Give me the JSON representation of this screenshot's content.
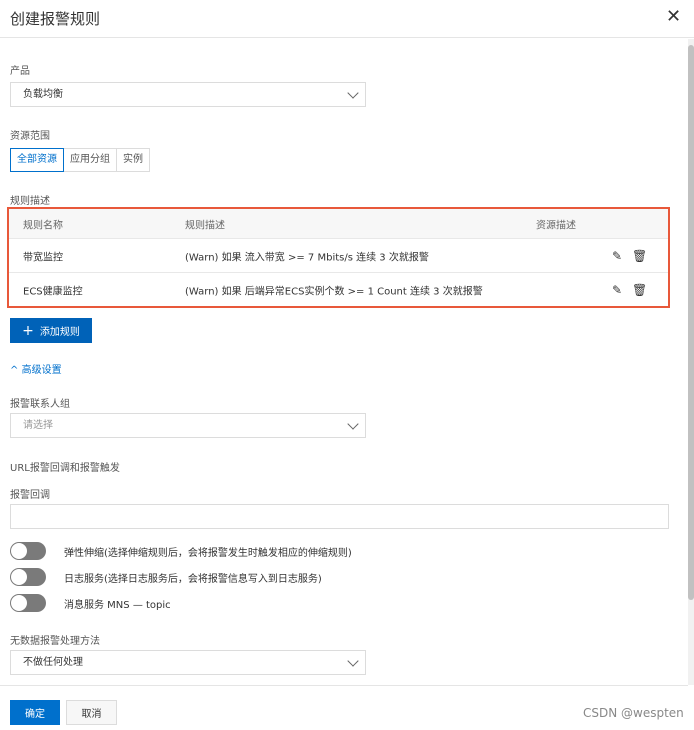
{
  "dialog": {
    "title": "创建报警规则",
    "close_icon": "close-icon"
  },
  "product": {
    "label": "产品",
    "value": "负载均衡"
  },
  "scope": {
    "label": "资源范围",
    "tabs": [
      "全部资源",
      "应用分组",
      "实例"
    ],
    "active": 0
  },
  "rules": {
    "label": "规则描述",
    "headers": [
      "规则名称",
      "规则描述",
      "资源描述"
    ],
    "rows": [
      {
        "name": "带宽监控",
        "desc": "(Warn) 如果 流入带宽 >= 7 Mbits/s 连续 3 次就报警"
      },
      {
        "name": "ECS健康监控",
        "desc": "(Warn) 如果 后端异常ECS实例个数 >= 1 Count 连续 3 次就报警"
      }
    ],
    "add_label": "添加规则"
  },
  "advanced": {
    "label": "高级设置"
  },
  "contacts": {
    "label": "报警联系人组",
    "placeholder": "请选择"
  },
  "url": {
    "section_label": "URL报警回调和报警触发",
    "callback_label": "报警回调",
    "callback_value": ""
  },
  "toggles": [
    {
      "label": "弹性伸缩(选择伸缩规则后，会将报警发生时触发相应的伸缩规则)",
      "on": false
    },
    {
      "label": "日志服务(选择日志服务后，会将报警信息写入到日志服务)",
      "on": false
    },
    {
      "label": "消息服务 MNS — topic",
      "on": false
    }
  ],
  "nodata": {
    "label": "无数据报警处理方法",
    "value": "不做任何处理"
  },
  "footer": {
    "ok": "确定",
    "cancel": "取消"
  },
  "watermark": "CSDN @wespten",
  "colors": {
    "primary": "#0062b8",
    "highlight": "#e8583a"
  }
}
